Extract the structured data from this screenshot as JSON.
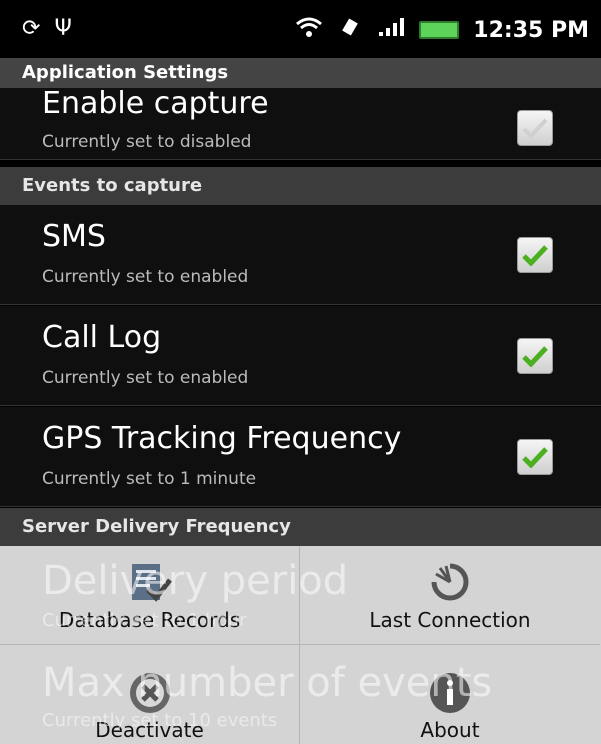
{
  "status": {
    "time": "12:35 PM"
  },
  "app_title": "Application Settings",
  "capture": {
    "title": "Enable capture",
    "subtitle": "Currently set to disabled"
  },
  "events_section": "Events to capture",
  "sms": {
    "title": "SMS",
    "subtitle": "Currently set to enabled"
  },
  "call_log": {
    "title": "Call Log",
    "subtitle": "Currently set to enabled"
  },
  "gps": {
    "title": "GPS Tracking Frequency",
    "subtitle": "Currently set to 1 minute"
  },
  "server_section": "Server Delivery Frequency",
  "behind": {
    "delivery_title": "Delivery period",
    "delivery_sub": "Currently set to 1 hour",
    "max_title": "Max number of events",
    "max_sub": "Currently set to 10 events"
  },
  "menu": {
    "database_records": "Database Records",
    "last_connection": "Last Connection",
    "deactivate": "Deactivate",
    "about": "About"
  },
  "colors": {
    "check_green": "#4caf1f",
    "section_bg": "#3c3c3c"
  }
}
